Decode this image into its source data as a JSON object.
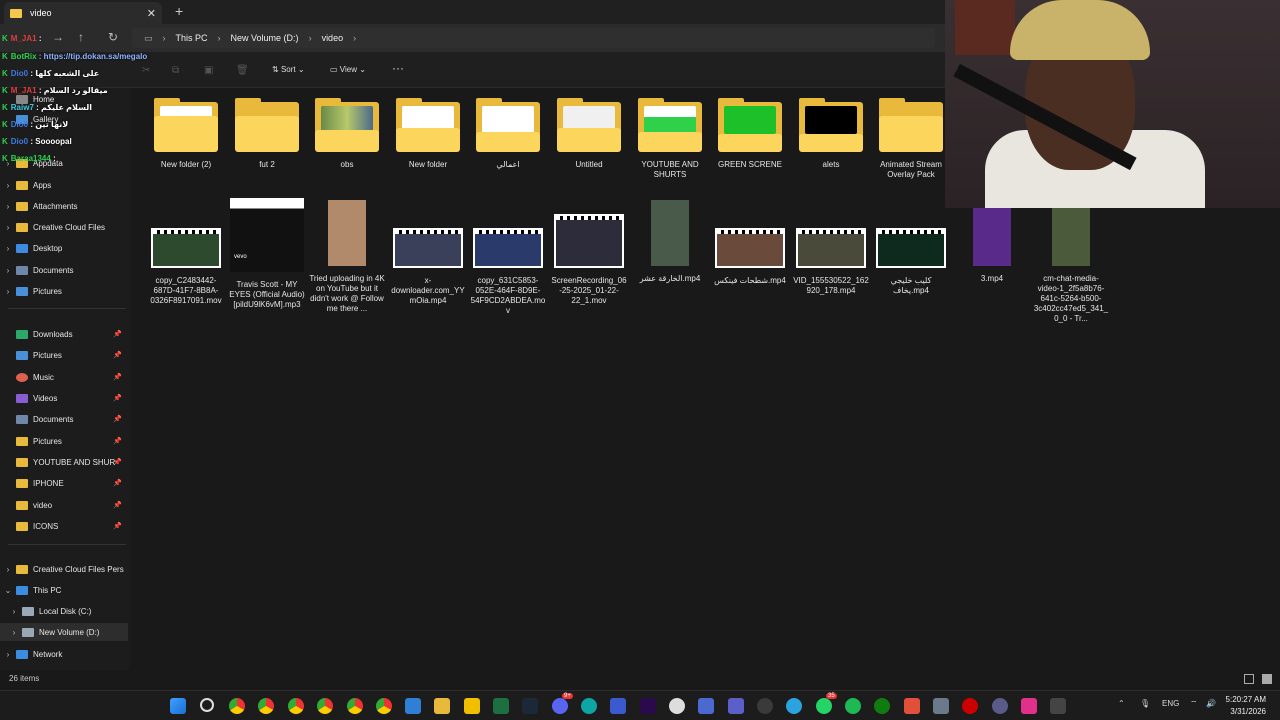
{
  "window": {
    "tab_title": "video"
  },
  "address": {
    "crumbs": [
      "This PC",
      "New Volume (D:)",
      "video"
    ]
  },
  "commands": {
    "sort": "Sort",
    "view": "View",
    "more": "···"
  },
  "sidebar": {
    "top_items": [
      {
        "label": "Home"
      },
      {
        "label": "Gallery"
      },
      {
        "label": "Appdata"
      },
      {
        "label": "Apps"
      },
      {
        "label": "Attachments"
      },
      {
        "label": "Creative Cloud Files"
      },
      {
        "label": "Desktop"
      },
      {
        "label": "Documents"
      },
      {
        "label": "Pictures"
      }
    ],
    "pinned": [
      {
        "label": "Downloads"
      },
      {
        "label": "Pictures"
      },
      {
        "label": "Music"
      },
      {
        "label": "Videos"
      },
      {
        "label": "Documents"
      },
      {
        "label": "Pictures"
      },
      {
        "label": "YOUTUBE AND SHUR"
      },
      {
        "label": "IPHONE"
      },
      {
        "label": "video"
      },
      {
        "label": "ICONS"
      }
    ],
    "tree": [
      {
        "label": "Creative Cloud Files Pers"
      },
      {
        "label": "This PC"
      },
      {
        "label": "Local Disk (C:)"
      },
      {
        "label": "New Volume (D:)"
      },
      {
        "label": "Network"
      }
    ]
  },
  "folders": [
    {
      "name": "New folder (2)"
    },
    {
      "name": "fut 2"
    },
    {
      "name": "obs"
    },
    {
      "name": "New folder"
    },
    {
      "name": "اعمالي"
    },
    {
      "name": "Untitled"
    },
    {
      "name": "YOUTUBE AND SHURTS"
    },
    {
      "name": "GREEN SCRENE"
    },
    {
      "name": "alets"
    },
    {
      "name": "Animated Stream Overlay Pack"
    }
  ],
  "files": [
    {
      "name": "copy_C2483442-687D-41F7-8B8A-0326F8917091.mov"
    },
    {
      "name": "Travis Scott - MY EYES (Official Audio) [pildU9lK6vM].mp3",
      "badge": "vevo"
    },
    {
      "name": "Tried uploading in 4K on YouTube but it didn't work @ Follow me there ..."
    },
    {
      "name": "x-downloader.com_YYmOia.mp4"
    },
    {
      "name": "copy_631C5853-052E-464F-8D9E-54F9CD2ABDEA.mov"
    },
    {
      "name": "ScreenRecording_06-25-2025_01-22-22_1.mov"
    },
    {
      "name": "الخارقة عشر.mp4"
    },
    {
      "name": "شطحات فينكس.mp4"
    },
    {
      "name": "VID_155530522_162920_178.mp4"
    },
    {
      "name": "كليب خليجي يخاف.mp4"
    },
    {
      "name": "3.mp4"
    },
    {
      "name": "cm-chat-media-video-1_2f5a8b76-641c-5264-b500-3c402cc47ed5_341_0_0 - Tr..."
    }
  ],
  "status": {
    "count": "26 items"
  },
  "chat": [
    {
      "user": "M_JA1",
      "msg": ":"
    },
    {
      "user": "BotRix",
      "msg": ": https://tip.dokan.sa/megalo"
    },
    {
      "user": "Dio0",
      "msg": ": على الشعبه كلها"
    },
    {
      "user": "M_JA1",
      "msg": ": ميقالو رد السلام"
    },
    {
      "user": "Raiw7",
      "msg": ": السلام عليكم"
    },
    {
      "user": "Dio0",
      "msg": ": لانها تين"
    },
    {
      "user": "Dio0",
      "msg": ": Soooopal"
    },
    {
      "user": "Baraa1344",
      "msg": ":"
    }
  ],
  "clock": {
    "time": "5:20:27 AM",
    "date": "3/31/2026"
  },
  "tray": {
    "lang": "ENG"
  },
  "taskbar_badges": {
    "discord": "9+",
    "whatsapp": "35"
  }
}
